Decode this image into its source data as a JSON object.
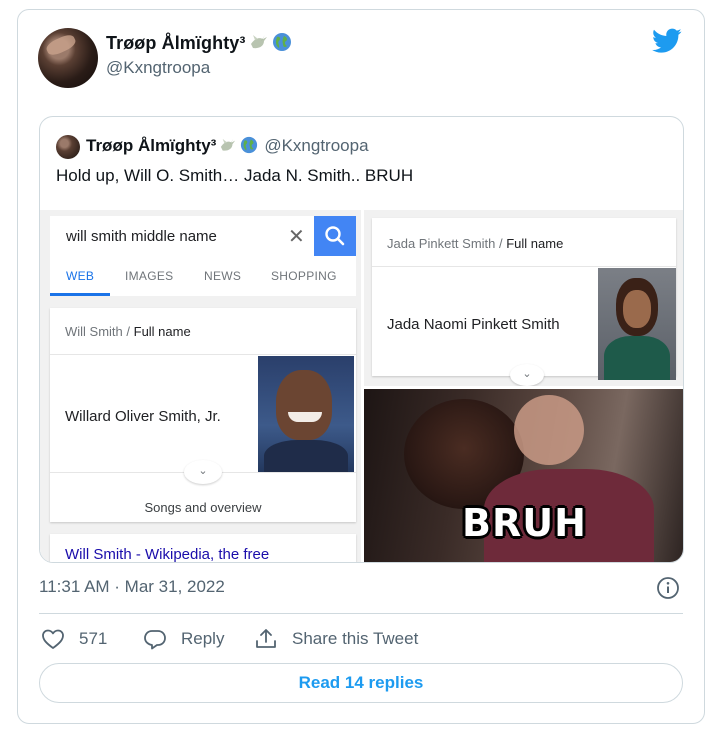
{
  "tweet": {
    "author_name": "Trøøp Ålmïghty³",
    "author_emojis": [
      "dove-icon",
      "globe-icon"
    ],
    "author_handle": "@Kxngtroopa",
    "timestamp": "11:31 AM · Mar 31, 2022",
    "likes_count": "571",
    "reply_label": "Reply",
    "share_label": "Share this Tweet",
    "read_replies_label": "Read 14 replies",
    "accent_color": "#1d9bf0"
  },
  "quoted_tweet": {
    "author_name": "Trøøp Ålmïghty³",
    "author_handle": "@Kxngtroopa",
    "text": "Hold up, Will O. Smith… Jada N. Smith.. BRUH",
    "media": {
      "left": {
        "search_query": "will smith middle name",
        "tabs": [
          "WEB",
          "IMAGES",
          "NEWS",
          "SHOPPING"
        ],
        "active_tab": "WEB",
        "crumb_entity": "Will Smith",
        "crumb_attr": "Full name",
        "answer": "Willard Oliver Smith, Jr.",
        "songs_label": "Songs and overview",
        "result_link": "Will Smith - Wikipedia, the free"
      },
      "right_top": {
        "crumb_entity": "Jada Pinkett Smith",
        "crumb_attr": "Full name",
        "answer": "Jada Naomi Pinkett Smith"
      },
      "right_bottom": {
        "caption": "BRUH"
      }
    }
  }
}
